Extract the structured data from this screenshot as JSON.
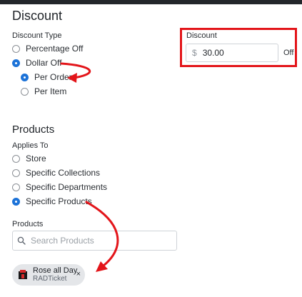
{
  "discount_section": {
    "title": "Discount",
    "type_label": "Discount Type",
    "options": [
      {
        "label": "Percentage Off",
        "selected": false
      },
      {
        "label": "Dollar Off",
        "selected": true
      }
    ],
    "sub_options": [
      {
        "label": "Per Order",
        "selected": true
      },
      {
        "label": "Per Item",
        "selected": false
      }
    ],
    "amount": {
      "label": "Discount",
      "currency_symbol": "$",
      "value": "30.00",
      "suffix": "Off"
    }
  },
  "products_section": {
    "title": "Products",
    "applies_to_label": "Applies To",
    "options": [
      {
        "label": "Store",
        "selected": false
      },
      {
        "label": "Specific Collections",
        "selected": false
      },
      {
        "label": "Specific Departments",
        "selected": false
      },
      {
        "label": "Specific Products",
        "selected": true
      }
    ],
    "products_label": "Products",
    "search_placeholder": "Search Products",
    "selected_products": [
      {
        "name": "Rose all Day",
        "vendor": "RADTicket",
        "remove_glyph": "×"
      }
    ]
  },
  "colors": {
    "accent": "#1d73d8",
    "annotation_red": "#e3151a",
    "top_bar": "#23262b"
  },
  "icons": {
    "search": "search-icon",
    "remove": "close-icon",
    "product_thumbnail": "product-thumbnail-icon"
  }
}
